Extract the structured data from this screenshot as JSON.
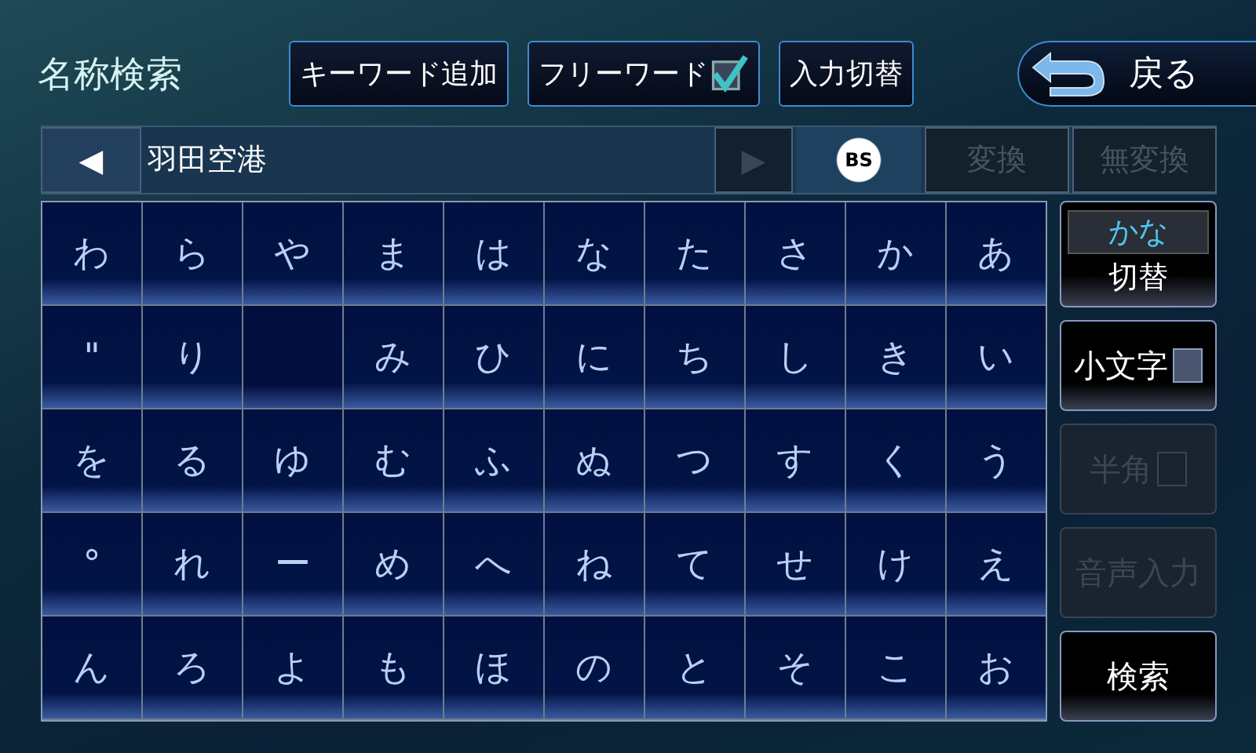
{
  "header": {
    "title": "名称検索",
    "buttons": [
      {
        "kind": "plain",
        "label": "キーワード追加"
      },
      {
        "kind": "check",
        "label": "フリーワード",
        "checked": true
      },
      {
        "kind": "plain",
        "label": "入力切替"
      }
    ],
    "back": {
      "label": "戻る"
    }
  },
  "input_bar": {
    "left_arrow": {
      "label": "◀",
      "disabled": false
    },
    "value": "羽田空港",
    "right_arrow": {
      "label": "▶",
      "disabled": true
    },
    "backspace": {
      "label": "BS"
    },
    "actions": [
      {
        "label": "変換",
        "disabled": true
      },
      {
        "label": "無変換",
        "disabled": true
      }
    ]
  },
  "keys": [
    [
      {
        "label": "わ"
      },
      {
        "label": "ら"
      },
      {
        "label": "や"
      },
      {
        "label": "ま"
      },
      {
        "label": "は"
      },
      {
        "label": "な"
      },
      {
        "label": "た"
      },
      {
        "label": "さ"
      },
      {
        "label": "か"
      },
      {
        "label": "あ"
      }
    ],
    [
      {
        "label": "\""
      },
      {
        "label": "り"
      },
      {
        "kind": "blank"
      },
      {
        "label": "み"
      },
      {
        "label": "ひ"
      },
      {
        "label": "に"
      },
      {
        "label": "ち"
      },
      {
        "label": "し"
      },
      {
        "label": "き"
      },
      {
        "label": "い"
      }
    ],
    [
      {
        "label": "を"
      },
      {
        "label": "る"
      },
      {
        "label": "ゆ"
      },
      {
        "label": "む"
      },
      {
        "label": "ふ"
      },
      {
        "label": "ぬ"
      },
      {
        "label": "つ"
      },
      {
        "label": "す"
      },
      {
        "label": "く"
      },
      {
        "label": "う"
      }
    ],
    [
      {
        "label": "°"
      },
      {
        "label": "れ"
      },
      {
        "label": "ー"
      },
      {
        "label": "め"
      },
      {
        "label": "へ"
      },
      {
        "label": "ね"
      },
      {
        "label": "て"
      },
      {
        "label": "せ"
      },
      {
        "label": "け"
      },
      {
        "label": "え"
      }
    ],
    [
      {
        "label": "ん"
      },
      {
        "label": "ろ"
      },
      {
        "label": "よ"
      },
      {
        "label": "も"
      },
      {
        "label": "ほ"
      },
      {
        "label": "の"
      },
      {
        "label": "と"
      },
      {
        "label": "そ"
      },
      {
        "label": "こ"
      },
      {
        "label": "お"
      }
    ]
  ],
  "side": [
    {
      "kind": "mode",
      "mode": "かな",
      "label": "切替"
    },
    {
      "kind": "check",
      "label": "小文字",
      "checked": false,
      "disabled": false
    },
    {
      "kind": "check",
      "label": "半角",
      "checked": false,
      "disabled": true
    },
    {
      "kind": "plain",
      "label": "音声入力",
      "disabled": true
    },
    {
      "kind": "plain",
      "label": "検索",
      "disabled": false
    }
  ]
}
